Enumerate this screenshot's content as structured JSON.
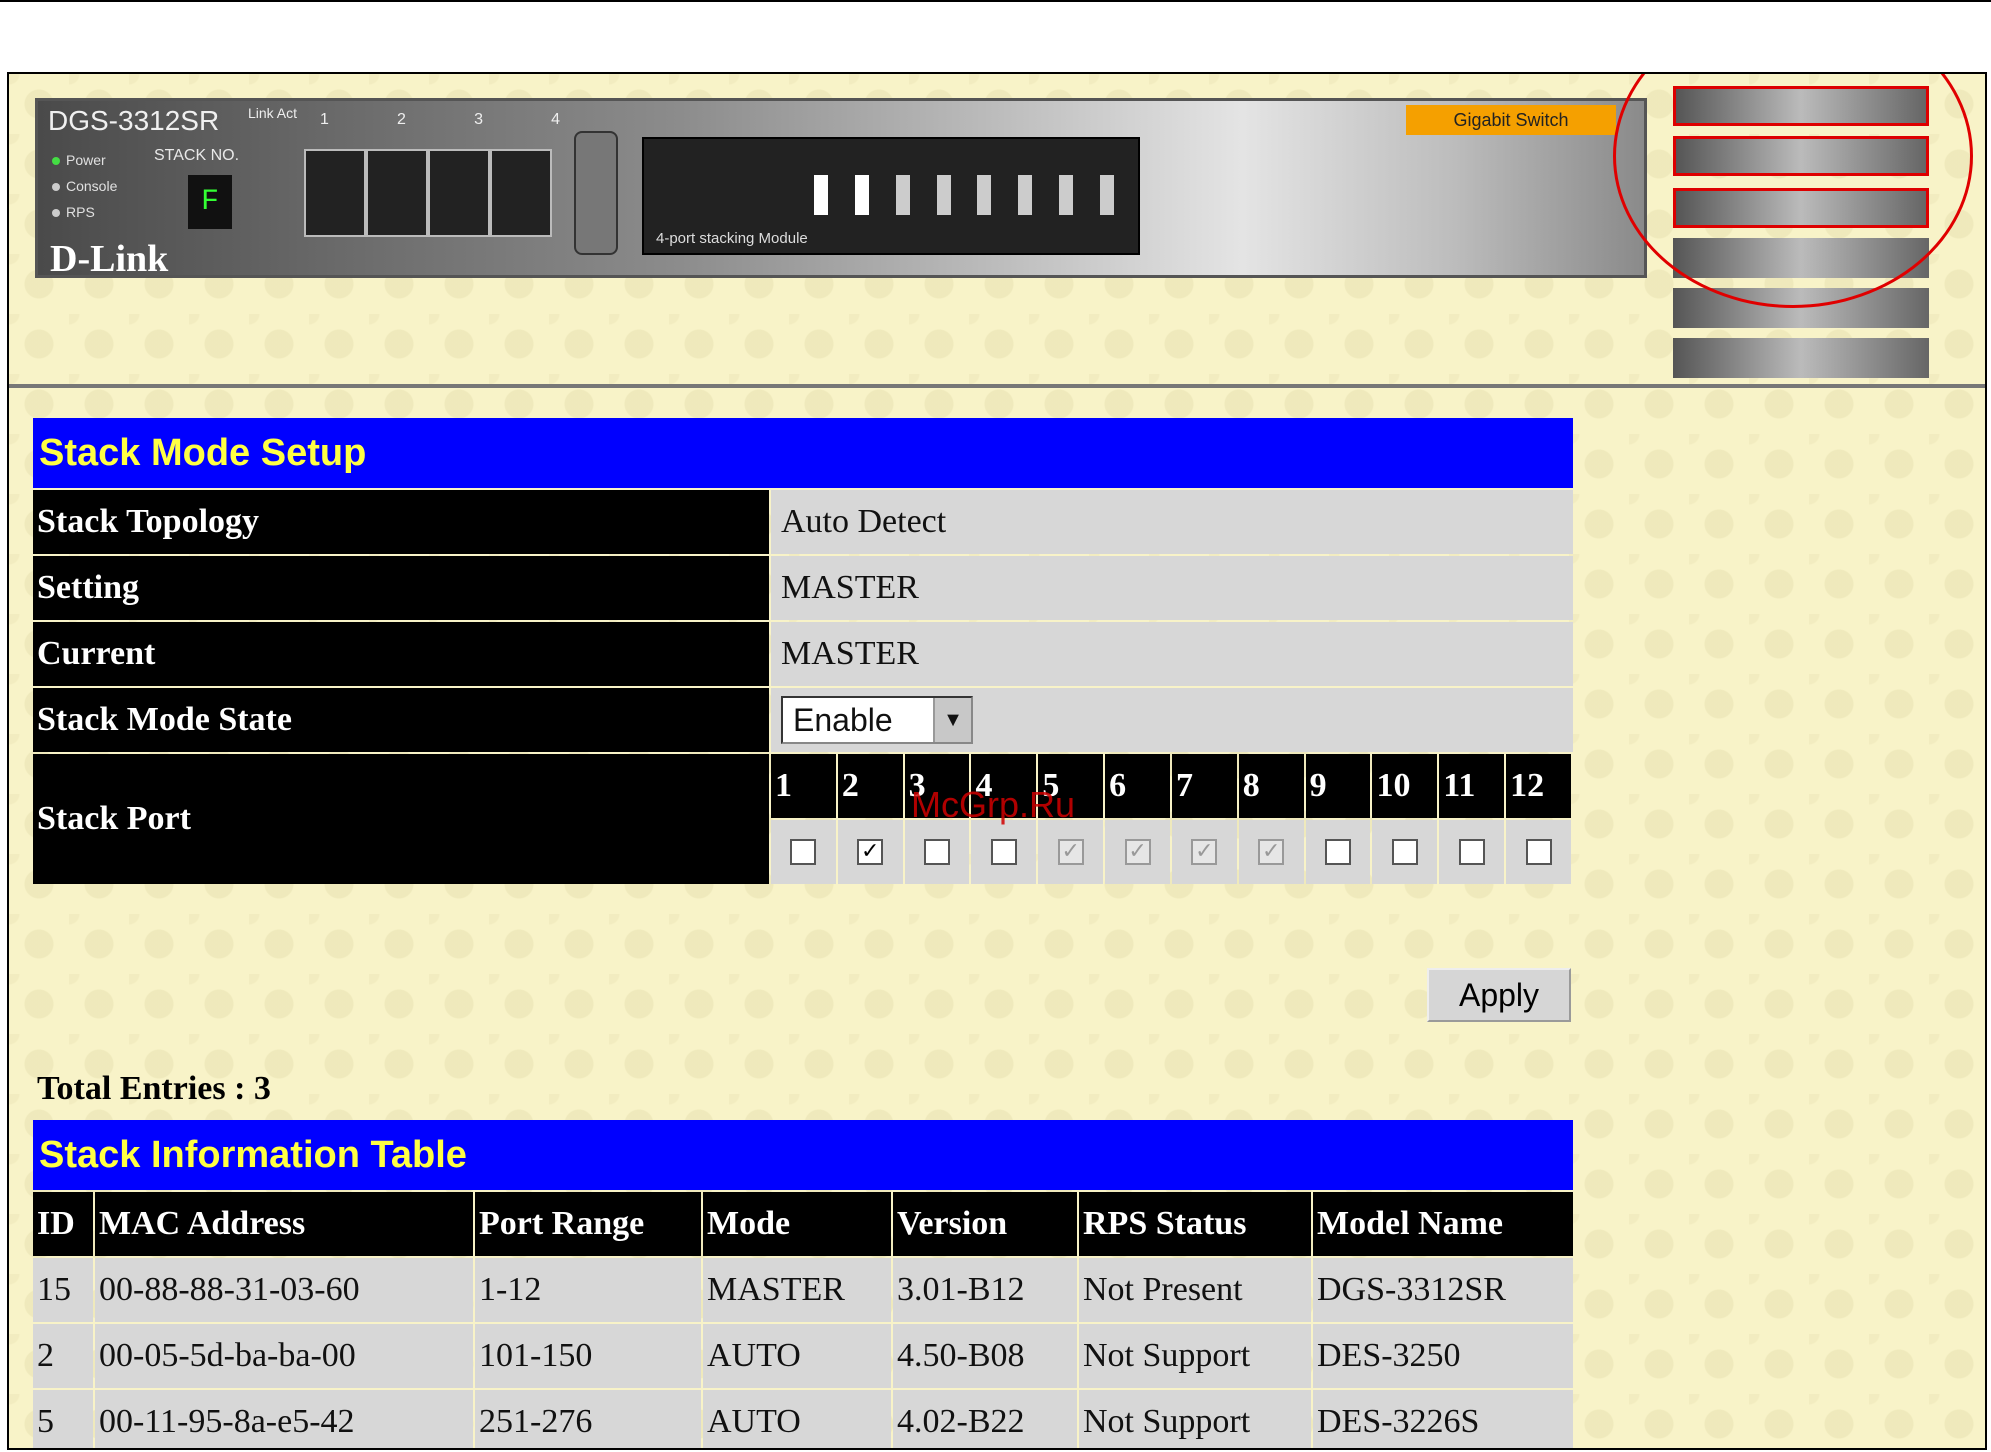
{
  "device": {
    "model": "DGS-3312SR",
    "logo": "D-Link",
    "stack_no_label": "STACK NO.",
    "stack_digit": "F",
    "led_labels": [
      "Power",
      "Console",
      "RPS"
    ],
    "link_act": "Link Act",
    "port_numbers": [
      "1",
      "2",
      "3",
      "4"
    ],
    "module_label": "4-port stacking Module",
    "gigabit_label": "Gigabit Switch"
  },
  "stack_mode": {
    "title": "Stack Mode Setup",
    "rows": [
      {
        "label": "Stack Topology",
        "value": "Auto Detect"
      },
      {
        "label": "Setting",
        "value": "MASTER"
      },
      {
        "label": "Current",
        "value": "MASTER"
      }
    ],
    "state_label": "Stack Mode State",
    "state_value": "Enable",
    "port_label": "Stack Port",
    "ports": [
      {
        "num": "1",
        "checked": false,
        "disabled": false
      },
      {
        "num": "2",
        "checked": true,
        "disabled": false
      },
      {
        "num": "3",
        "checked": false,
        "disabled": false
      },
      {
        "num": "4",
        "checked": false,
        "disabled": false
      },
      {
        "num": "5",
        "checked": true,
        "disabled": true
      },
      {
        "num": "6",
        "checked": true,
        "disabled": true
      },
      {
        "num": "7",
        "checked": true,
        "disabled": true
      },
      {
        "num": "8",
        "checked": true,
        "disabled": true
      },
      {
        "num": "9",
        "checked": false,
        "disabled": false
      },
      {
        "num": "10",
        "checked": false,
        "disabled": false
      },
      {
        "num": "11",
        "checked": false,
        "disabled": false
      },
      {
        "num": "12",
        "checked": false,
        "disabled": false
      }
    ],
    "apply_label": "Apply"
  },
  "total_entries": "Total Entries : 3",
  "info_table": {
    "title": "Stack Information Table",
    "columns": [
      "ID",
      "MAC Address",
      "Port Range",
      "Mode",
      "Version",
      "RPS Status",
      "Model Name"
    ],
    "rows": [
      [
        "15",
        "00-88-88-31-03-60",
        "1-12",
        "MASTER",
        "3.01-B12",
        "Not Present",
        "DGS-3312SR"
      ],
      [
        "2",
        "00-05-5d-ba-ba-00",
        "101-150",
        "AUTO",
        "4.50-B08",
        "Not Support",
        "DES-3250"
      ],
      [
        "5",
        "00-11-95-8a-e5-42",
        "251-276",
        "AUTO",
        "4.02-B22",
        "Not Support",
        "DES-3226S"
      ]
    ]
  },
  "watermark": "McGrp.Ru",
  "colors": {
    "header_blue": "#0000ff",
    "header_text": "#ffff44",
    "label_bg": "#000000",
    "value_bg": "#d7d7d7",
    "highlight": "#e00000"
  }
}
